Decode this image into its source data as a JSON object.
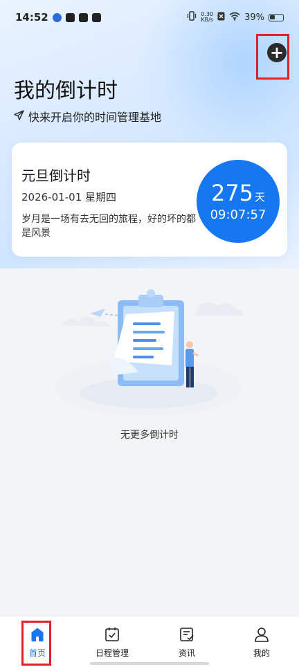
{
  "status_bar": {
    "time": "14:52",
    "net_speed_value": "0.30",
    "net_speed_unit": "KB/s",
    "battery_percent": "39%"
  },
  "header": {
    "title": "我的倒计时",
    "subtitle": "快来开启你的时间管理基地",
    "add_button_icon": "plus-icon"
  },
  "countdown_card": {
    "title": "元旦倒计时",
    "date": "2026-01-01 星期四",
    "quote": "岁月是一场有去无回的旅程，好的坏的都是风景",
    "days": "275",
    "days_unit": "天",
    "time_left": "09:07:57",
    "accent_color": "#1677f0"
  },
  "empty_state": {
    "text": "无更多倒计时"
  },
  "bottom_nav": {
    "items": [
      {
        "label": "首页",
        "icon": "home-icon",
        "active": true
      },
      {
        "label": "日程管理",
        "icon": "calendar-check-icon",
        "active": false
      },
      {
        "label": "资讯",
        "icon": "news-icon",
        "active": false
      },
      {
        "label": "我的",
        "icon": "user-icon",
        "active": false
      }
    ]
  },
  "highlight_color": "#e0202a"
}
